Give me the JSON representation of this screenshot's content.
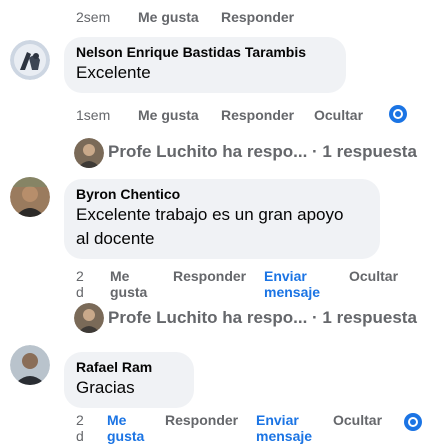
{
  "top_actions": {
    "time": "2sem",
    "like": "Me gusta",
    "reply": "Responder"
  },
  "comments": [
    {
      "author": "Nelson Enrique Bastidas Tarambis",
      "text": "Excelente",
      "time": "1sem",
      "like": "Me gusta",
      "reply": "Responder",
      "hide": "Ocultar",
      "reply_summary": {
        "author": "Profe Luchito ha respo...",
        "count": "· 1 respuesta"
      }
    },
    {
      "author": "Byron Chentico",
      "text_line1": "Excelente trabajo es un gran apoyo",
      "text_line2": "al docente",
      "time_a": "2",
      "time_b": "d",
      "like_a": "Me",
      "like_b": "gusta",
      "reply": "Responder",
      "message_a": "Enviar",
      "message_b": "mensaje",
      "hide": "Ocultar",
      "reply_summary": {
        "author": "Profe Luchito ha respo...",
        "count": "· 1 respuesta"
      }
    },
    {
      "author": "Rafael Ram",
      "text": "Gracias",
      "time_a": "2",
      "time_b": "d",
      "like_a": "Me",
      "like_b": "gusta",
      "reply": "Responder",
      "message_a": "Enviar",
      "message_b": "mensaje",
      "hide": "Ocultar"
    }
  ],
  "icons": {
    "messenger": "messenger-icon"
  },
  "colors": {
    "bubble": "#f0f2f5",
    "meta_text": "#65676b",
    "link_blue": "#1b74e4"
  }
}
